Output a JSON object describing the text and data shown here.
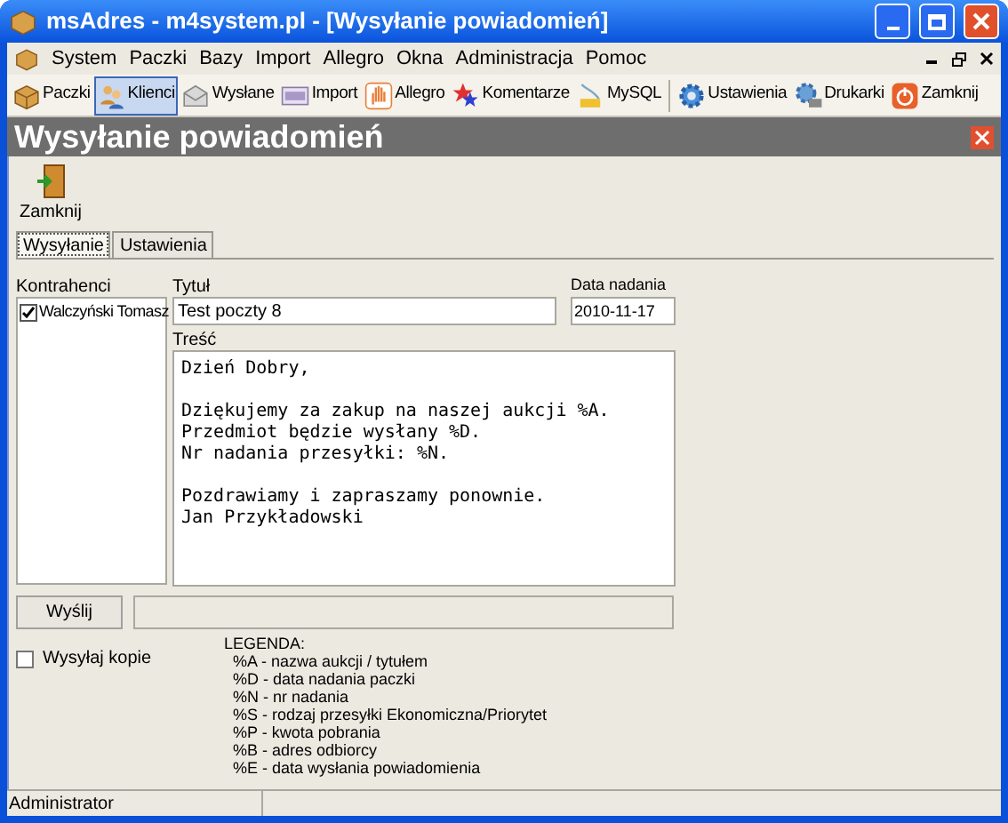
{
  "window": {
    "title": "msAdres - m4system.pl - [Wysyłanie powiadomień]"
  },
  "menu": [
    "System",
    "Paczki",
    "Bazy",
    "Import",
    "Allegro",
    "Okna",
    "Administracja",
    "Pomoc"
  ],
  "toolbar": [
    {
      "label": "Paczki",
      "selected": false
    },
    {
      "label": "Klienci",
      "selected": true
    },
    {
      "label": "Wysłane",
      "selected": false
    },
    {
      "label": "Import",
      "selected": false
    },
    {
      "label": "Allegro",
      "selected": false
    },
    {
      "label": "Komentarze",
      "selected": false
    },
    {
      "label": "MySQL",
      "selected": false
    },
    {
      "label": "Ustawienia",
      "selected": false
    },
    {
      "label": "Drukarki",
      "selected": false
    },
    {
      "label": "Zamknij",
      "selected": false
    }
  ],
  "form": {
    "title": "Wysyłanie powiadomień",
    "close_button": "Zamknij",
    "tabs": [
      {
        "label": "Wysyłanie",
        "selected": true
      },
      {
        "label": "Ustawienia",
        "selected": false
      }
    ],
    "contractors_label": "Kontrahenci",
    "contractors": [
      {
        "name": "Walczyński Tomasz",
        "checked": true
      }
    ],
    "title_label": "Tytuł",
    "title_value": "Test poczty 8",
    "date_label": "Data nadania",
    "date_value": "2010-11-17",
    "body_label": "Treść",
    "body_value": "Dzień Dobry,\n\nDziękujemy za zakup na naszej aukcji %A.\nPrzedmiot będzie wysłany %D.\nNr nadania przesyłki: %N.\n\nPozdrawiamy i zapraszamy ponownie.\nJan Przykładowski",
    "send_button": "Wyślij",
    "progress": {
      "level": 0
    },
    "copy_checkbox": {
      "label": "Wysyłaj kopie",
      "checked": false
    },
    "legend_title": "LEGENDA:",
    "legend": [
      "%A - nazwa aukcji / tytułem",
      "%D - data nadania paczki",
      "%N - nr nadania",
      "%S - rodzaj przesyłki Ekonomiczna/Priorytet",
      "%P - kwota pobrania",
      "%B - adres odbiorcy",
      "%E - data wysłania powiadomienia"
    ]
  },
  "status_bar": [
    "Administrator"
  ]
}
